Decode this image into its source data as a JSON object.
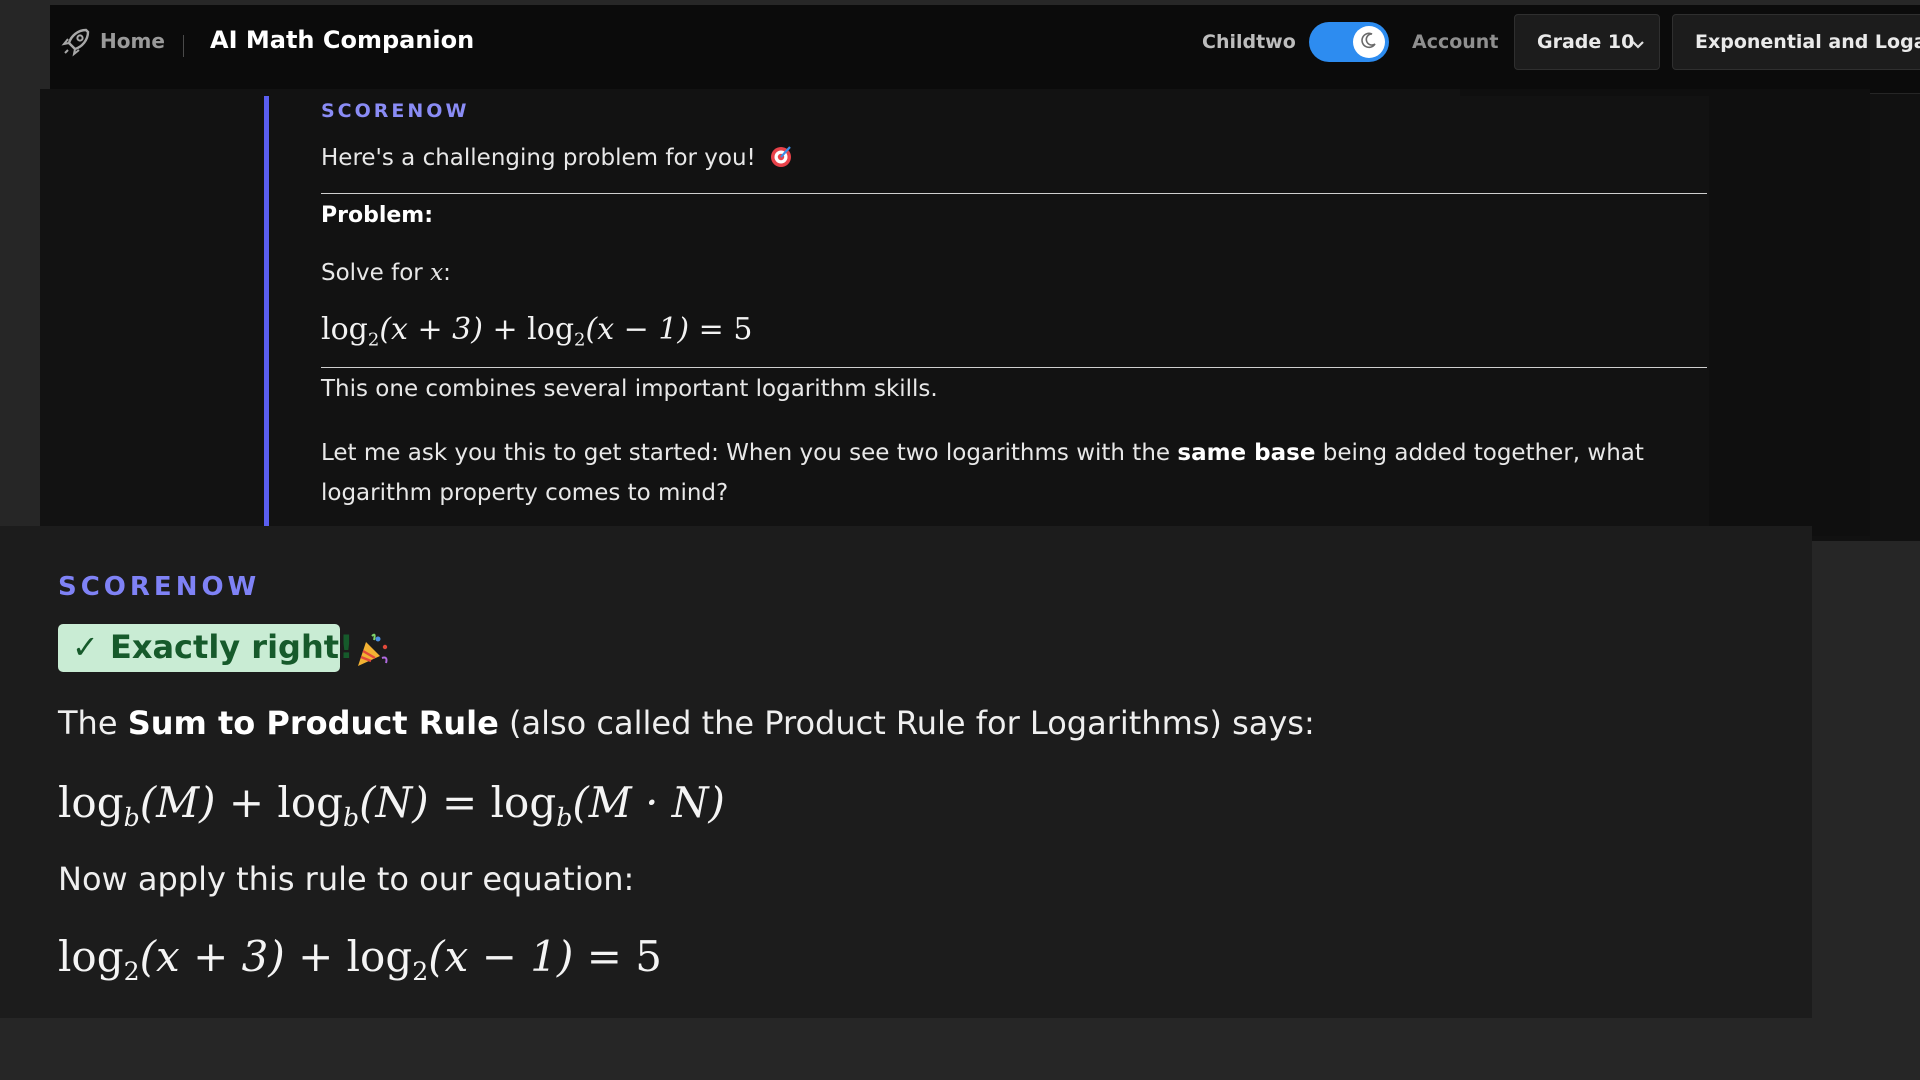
{
  "topbar": {
    "home_label": "Home",
    "app_title": "AI Math Companion",
    "user_name": "Childtwo",
    "account_label": "Account",
    "grade_selected": "Grade 10",
    "topic_selected": "Exponential and Logarithmic Functions",
    "toggle_on": true,
    "toggle_color": "#2d8cf0"
  },
  "message1": {
    "sender": "SCORENOW",
    "intro": "Here's a challenging problem for you!",
    "intro_emoji": "🎯",
    "problem_label": "Problem:",
    "solve_prefix": "Solve for ",
    "solve_var": "x",
    "solve_suffix": ":",
    "equation": {
      "log": "log",
      "base": "2",
      "arg1": "(x + 3)",
      "plus": " + ",
      "arg2": "(x − 1)",
      "rhs": " = 5"
    },
    "combine_text": "This one combines several important logarithm skills.",
    "question_pre": "Let me ask you this to get started: When you see two logarithms with the ",
    "question_bold": "same base",
    "question_post": " being added together, what logarithm property comes to mind?"
  },
  "message2": {
    "sender": "SCORENOW",
    "badge": "✓ Exactly right!",
    "badge_color": "#c9ecd4",
    "rule_pre": "The ",
    "rule_bold": "Sum to Product Rule",
    "rule_post": " (also called the Product Rule for Logarithms) says:",
    "rule_equation": {
      "log": "log",
      "base": "b",
      "m": "(M)",
      "plus": " + ",
      "n": "(N)",
      "eq": " = ",
      "mn": "(M · N)"
    },
    "apply_text": "Now apply this rule to our equation:",
    "equation": {
      "log": "log",
      "base": "2",
      "arg1": "(x + 3)",
      "plus": " + ",
      "arg2": "(x − 1)",
      "rhs": " = 5"
    }
  },
  "colors": {
    "accent": "#5a5ef0",
    "sender": "#8a8cf5",
    "background": "#121212"
  },
  "icons": {
    "brand": "rocket-icon",
    "toggle": "moon-icon",
    "grade_dropdown": "chevron-down-icon",
    "intro_emoji": "target-icon",
    "badge_emoji": "party-popper-icon"
  }
}
